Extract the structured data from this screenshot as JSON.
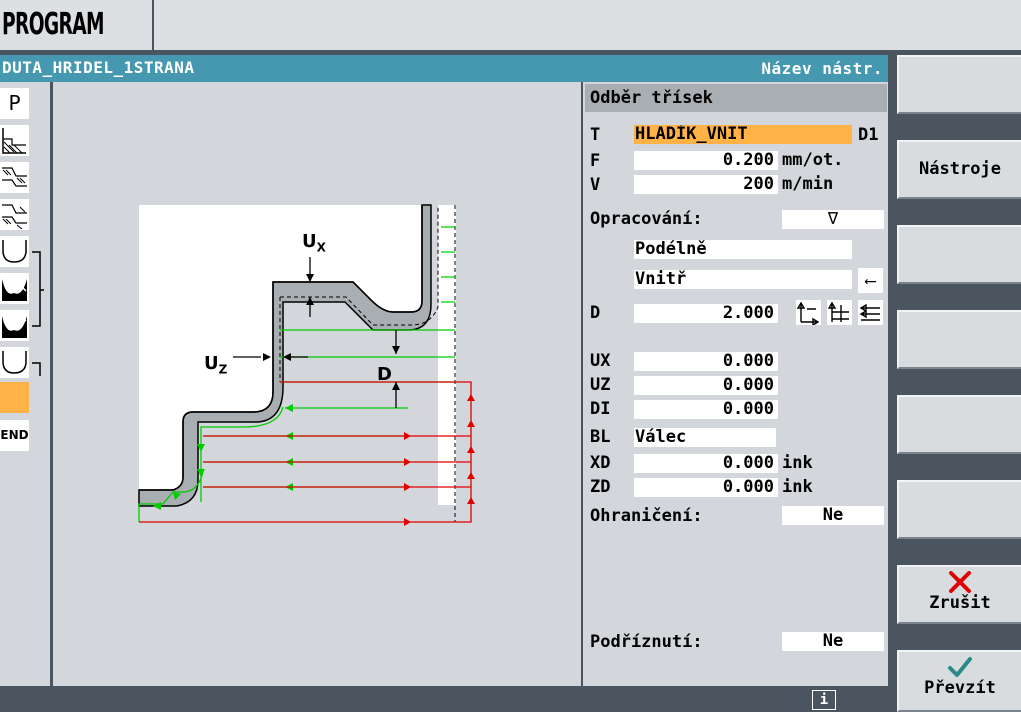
{
  "header": {
    "area_title": "PROGRAM"
  },
  "title_bar": {
    "program_name": "DUTA_HRIDEL_1STRANA",
    "right_label": "Název nástr."
  },
  "left_strip": {
    "items": [
      {
        "name": "program-header",
        "label": "P"
      },
      {
        "name": "contour-turning",
        "label": ""
      },
      {
        "name": "contour-parallel",
        "label": ""
      },
      {
        "name": "contour-finish",
        "label": ""
      },
      {
        "name": "groove-1",
        "label": ""
      },
      {
        "name": "groove-2",
        "label": ""
      },
      {
        "name": "groove-3",
        "label": ""
      },
      {
        "name": "relief-cut",
        "label": ""
      },
      {
        "name": "current-step",
        "label": ""
      },
      {
        "name": "end",
        "label": "END"
      }
    ]
  },
  "diagram": {
    "label_ux": "U",
    "label_ux_sub": "X",
    "label_uz": "U",
    "label_uz_sub": "Z",
    "label_d": "D"
  },
  "params": {
    "header": "Odběr třísek",
    "t_label": "T",
    "t_value": "HLADÍK_VNIT",
    "t_edge": "D1",
    "f_label": "F",
    "f_value": "0.200",
    "f_unit": "mm/ot.",
    "v_label": "V",
    "v_value": "200",
    "v_unit": "m/min",
    "machining_label": "Opracování:",
    "machining_value": "∇",
    "direction_value": "Podélně",
    "position_value": "Vnitř",
    "position_arrow": "⟵",
    "d_label": "D",
    "d_value": "2.000",
    "ux_label": "UX",
    "ux_value": "0.000",
    "uz_label": "UZ",
    "uz_value": "0.000",
    "di_label": "DI",
    "di_value": "0.000",
    "bl_label": "BL",
    "bl_value": "Válec",
    "xd_label": "XD",
    "xd_value": "0.000",
    "xd_unit": "ink",
    "zd_label": "ZD",
    "zd_value": "0.000",
    "zd_unit": "ink",
    "limit_label": "Ohraničení:",
    "limit_value": "Ne",
    "undercut_label": "Podříznutí:",
    "undercut_value": "Ne"
  },
  "softkeys": [
    {
      "label": ""
    },
    {
      "label": "Nástroje"
    },
    {
      "label": ""
    },
    {
      "label": ""
    },
    {
      "label": ""
    },
    {
      "label": ""
    },
    {
      "label": "Zrušit"
    },
    {
      "label": "Převzít"
    }
  ],
  "status": {
    "info_icon": "i"
  },
  "colors": {
    "title_bar": "#4698b0",
    "highlight": "#ffb347",
    "green": "#00cc00",
    "red": "#e00000",
    "panel": "#d3d6da"
  }
}
